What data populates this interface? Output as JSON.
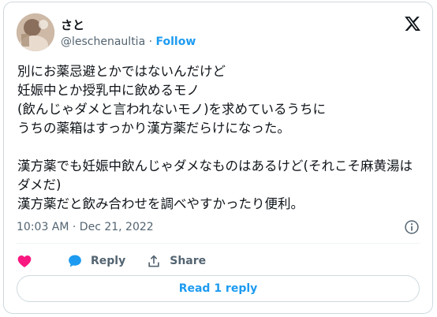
{
  "author": {
    "name": "さと",
    "handle": "@leschenaultia",
    "separator": "·",
    "follow_label": "Follow"
  },
  "tweet": {
    "text": "別にお薬忌避とかではないんだけど\n妊娠中とか授乳中に飲めるモノ\n(飲んじゃダメと言われないモノ)を求めているうちに\nうちの薬箱はすっかり漢方薬だらけになった。\n\n漢方薬でも妊娠中飲んじゃダメなものはあるけど(それこそ麻黄湯はダメだ)\n漢方薬だと飲み合わせを調べやすかったり便利。",
    "timestamp": "10:03 AM · Dec 21, 2022"
  },
  "actions": {
    "reply_label": "Reply",
    "share_label": "Share",
    "read_replies_label": "Read 1 reply"
  },
  "colors": {
    "accent": "#1d9bf0",
    "heart": "#f91880",
    "muted": "#536471"
  }
}
